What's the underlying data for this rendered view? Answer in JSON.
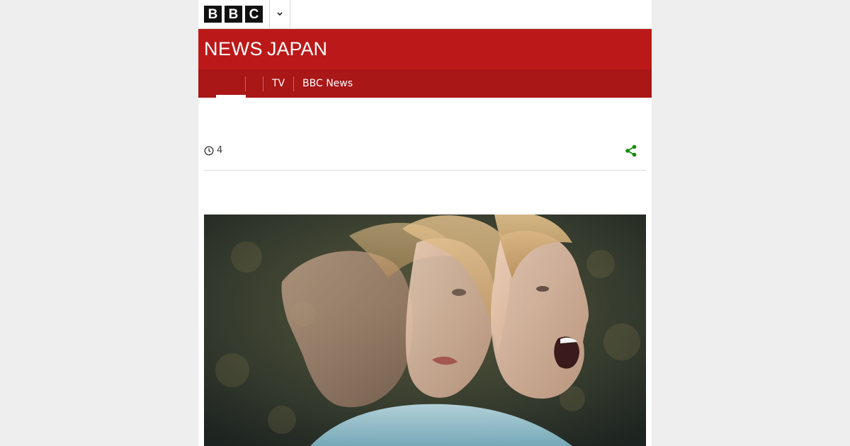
{
  "brand": {
    "bbc_letters": [
      "B",
      "B",
      "C"
    ]
  },
  "masthead": {
    "news": "NEWS",
    "region": "JAPAN"
  },
  "nav": {
    "items": [
      "TV",
      "BBC News"
    ]
  },
  "article": {
    "read_count": "4"
  },
  "icons": {
    "clock": "clock-icon",
    "share": "share-icon",
    "more": "chevron-down-icon"
  },
  "colors": {
    "brand_red": "#bb1919",
    "nav_red": "#a91717",
    "share_green": "#118c0a"
  }
}
